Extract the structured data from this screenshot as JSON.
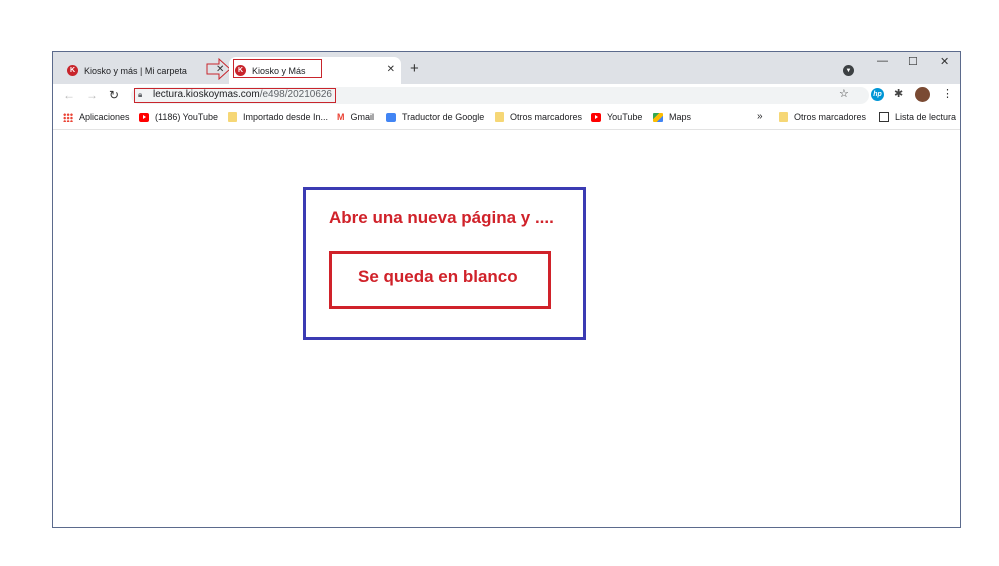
{
  "tabs": [
    {
      "title": "Kiosko y más | Mi carpeta",
      "favicon": "K"
    },
    {
      "title": "Kiosko y Más",
      "favicon": "K"
    }
  ],
  "toolbar": {
    "url_domain": "lectura.kioskoymas.com",
    "url_path": "/e498/20210626"
  },
  "bookmarks": {
    "items": [
      {
        "label": "Aplicaciones",
        "icon": "apps-grid-icon"
      },
      {
        "label": "(1186) YouTube",
        "icon": "youtube-icon"
      },
      {
        "label": "Importado desde In...",
        "icon": "folder-icon"
      },
      {
        "label": "Gmail",
        "icon": "gmail-icon"
      },
      {
        "label": "Traductor de Google",
        "icon": "translate-icon"
      },
      {
        "label": "Otros marcadores",
        "icon": "folder-icon"
      },
      {
        "label": "YouTube",
        "icon": "youtube-icon"
      },
      {
        "label": "Maps",
        "icon": "maps-icon"
      }
    ],
    "overflow": "»",
    "other_bookmarks": "Otros marcadores",
    "reading_list": "Lista de lectura"
  },
  "annotation": {
    "headline": "Abre una nueva página y ....",
    "note": "Se queda en blanco",
    "outer_color": "#3b3bb3",
    "accent_color": "#d0222a"
  }
}
